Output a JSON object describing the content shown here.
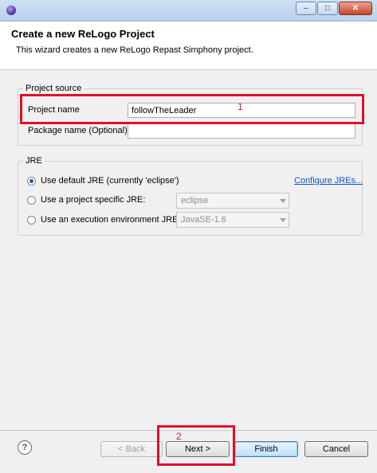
{
  "header": {
    "title": "Create a new ReLogo Project",
    "description": "This wizard creates a new ReLogo Repast Simphony project."
  },
  "project_source": {
    "group_title": "Project source",
    "project_name_label": "Project name",
    "project_name_value": "followTheLeader",
    "package_name_label": "Package name (Optional)",
    "package_name_value": ""
  },
  "jre": {
    "group_title": "JRE",
    "options": [
      {
        "label": "Use default JRE (currently 'eclipse')",
        "checked": true
      },
      {
        "label": "Use a project specific JRE:",
        "checked": false
      },
      {
        "label": "Use an execution environment JRE:",
        "checked": false
      }
    ],
    "configure_link": "Configure JREs...",
    "specific_jre_value": "eclipse",
    "execution_env_value": "JavaSE-1.6"
  },
  "footer": {
    "help_glyph": "?",
    "back": "< Back",
    "next": "Next >",
    "finish": "Finish",
    "cancel": "Cancel"
  },
  "annotations": {
    "label_1": "1",
    "label_2": "2",
    "color": "#e0102a"
  },
  "window": {
    "buttons": [
      "minimize-icon",
      "maximize-icon",
      "close-icon"
    ]
  }
}
